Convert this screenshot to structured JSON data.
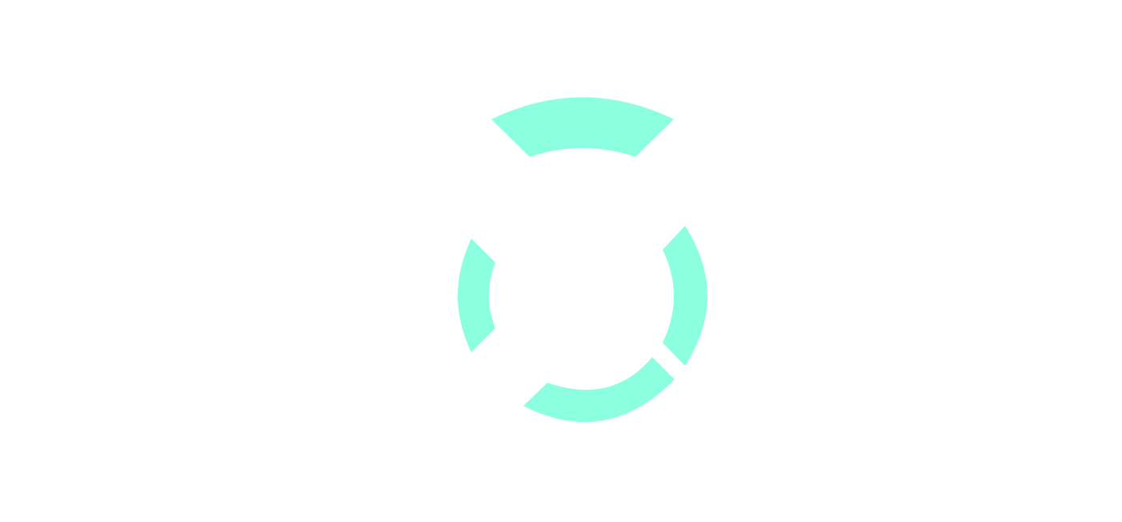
{
  "loader": {
    "icon": "segmented-ring-spinner-icon",
    "color": "#8cffe0",
    "background": "#ffffff",
    "segment_count": 4
  }
}
